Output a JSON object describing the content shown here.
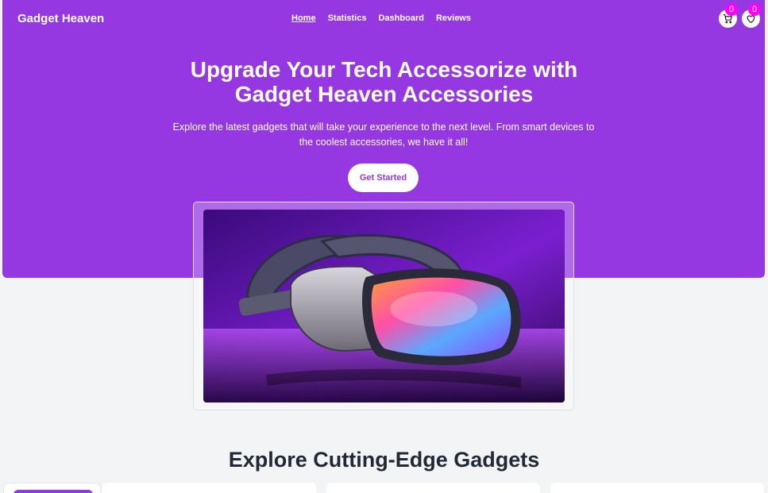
{
  "brand": "Gadget Heaven",
  "nav": [
    {
      "label": "Home",
      "active": true
    },
    {
      "label": "Statistics",
      "active": false
    },
    {
      "label": "Dashboard",
      "active": false
    },
    {
      "label": "Reviews",
      "active": false
    }
  ],
  "cart": {
    "icon": "cart-icon",
    "count": "0"
  },
  "wishlist": {
    "icon": "heart-icon",
    "count": "0"
  },
  "hero": {
    "title_line1": "Upgrade Your Tech Accessorize with",
    "title_line2": "Gadget Heaven Accessories",
    "subtitle_line1": "Explore the latest gadgets that will take your experience to the next level. From smart devices to",
    "subtitle_line2": "the coolest accessories, we have it all!",
    "cta_label": "Get Started"
  },
  "banner": {
    "image": "vr-headset-image"
  },
  "section": {
    "title": "Explore Cutting-Edge Gadgets"
  },
  "colors": {
    "primary": "#9538e2",
    "badge": "#ff00ff",
    "background": "#f3f4f6"
  }
}
